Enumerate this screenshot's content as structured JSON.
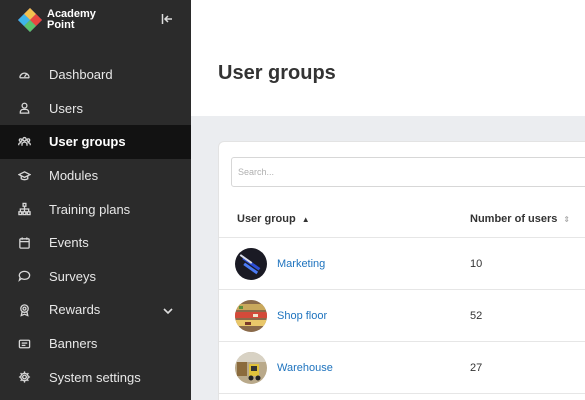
{
  "brand": {
    "line1": "Academy",
    "line2": "Point"
  },
  "nav": [
    {
      "label": "Dashboard",
      "icon": "dashboard-icon",
      "active": false
    },
    {
      "label": "Users",
      "icon": "user-icon",
      "active": false
    },
    {
      "label": "User groups",
      "icon": "user-groups-icon",
      "active": true
    },
    {
      "label": "Modules",
      "icon": "graduation-cap-icon",
      "active": false
    },
    {
      "label": "Training plans",
      "icon": "sitemap-icon",
      "active": false
    },
    {
      "label": "Events",
      "icon": "calendar-icon",
      "active": false
    },
    {
      "label": "Surveys",
      "icon": "chat-bubble-icon",
      "active": false
    },
    {
      "label": "Rewards",
      "icon": "award-icon",
      "active": false,
      "expandable": true
    },
    {
      "label": "Banners",
      "icon": "banner-icon",
      "active": false
    },
    {
      "label": "System settings",
      "icon": "gear-icon",
      "active": false
    }
  ],
  "page": {
    "title": "User groups"
  },
  "search": {
    "placeholder": "Search..."
  },
  "table": {
    "columns": [
      {
        "label": "User group",
        "sort": "ascending"
      },
      {
        "label": "Number of users",
        "sort": "unsorted"
      }
    ],
    "rows": [
      {
        "name": "Marketing",
        "users": "10",
        "avatar": "marketing-avatar"
      },
      {
        "name": "Shop floor",
        "users": "52",
        "avatar": "shop-floor-avatar"
      },
      {
        "name": "Warehouse",
        "users": "27",
        "avatar": "warehouse-avatar"
      }
    ]
  },
  "colors": {
    "sidebar": "#2b2b2b",
    "active_item": "#121212",
    "link": "#1e73be",
    "background": "#ebedf0"
  }
}
